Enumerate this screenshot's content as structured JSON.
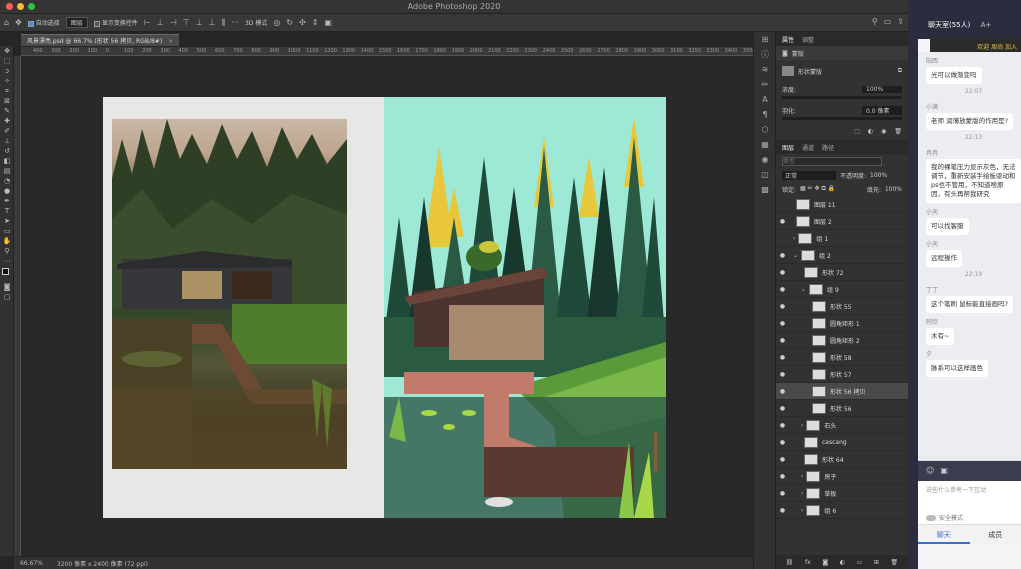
{
  "window": {
    "title": "Adobe Photoshop 2020"
  },
  "options_bar": {
    "auto_select_label": "自动选择",
    "auto_select_value": "图层",
    "show_transform_label": "显示变换控件",
    "mode_label": "3D 模式"
  },
  "document": {
    "tab_title": "风景漂亮.psd @ 66.7% (形状 56 拷贝, RGB/8#)"
  },
  "ruler_ticks": [
    "400",
    "300",
    "200",
    "100",
    "0",
    "100",
    "200",
    "300",
    "400",
    "500",
    "600",
    "700",
    "800",
    "900",
    "1000",
    "1100",
    "1200",
    "1300",
    "1400",
    "1500",
    "1600",
    "1700",
    "1800",
    "1900",
    "2000",
    "2100",
    "2200",
    "2300",
    "2400",
    "2500",
    "2600",
    "2700",
    "2800",
    "2900",
    "3000",
    "3100",
    "3200",
    "3300",
    "3400",
    "3500",
    "3600"
  ],
  "status": {
    "zoom": "66.67%",
    "doc_size": "3200 像素 x 2400 像素 (72 ppi)"
  },
  "properties": {
    "tabs": [
      "属性",
      "调整"
    ],
    "header": "蒙版",
    "mask_type": "形状蒙版",
    "density_label": "浓度:",
    "density_value": "100%",
    "feather_label": "羽化:",
    "feather_value": "0.0 像素"
  },
  "layers_panel": {
    "tabs": [
      "图层",
      "通道",
      "路径"
    ],
    "search_placeholder": "类型",
    "blend_mode": "正常",
    "opacity_label": "不透明度:",
    "opacity_value": "100%",
    "lock_label": "锁定:",
    "fill_label": "填充:",
    "fill_value": "100%",
    "layers": [
      {
        "name": "图层 11",
        "eye": "",
        "indent": 0,
        "fold": "",
        "selected": false
      },
      {
        "name": "图层 2",
        "eye": "●",
        "indent": 0,
        "fold": "",
        "selected": false
      },
      {
        "name": "组 1",
        "eye": "",
        "indent": 0,
        "fold": "›",
        "selected": false
      },
      {
        "name": "组 2",
        "eye": "●",
        "indent": 0,
        "fold": "⌄",
        "selected": false
      },
      {
        "name": "形状 72",
        "eye": "●",
        "indent": 1,
        "fold": "",
        "selected": false
      },
      {
        "name": "组 9",
        "eye": "●",
        "indent": 1,
        "fold": "⌄",
        "selected": false
      },
      {
        "name": "形状 55",
        "eye": "●",
        "indent": 2,
        "fold": "",
        "selected": false
      },
      {
        "name": "圆角矩形 1",
        "eye": "●",
        "indent": 2,
        "fold": "",
        "selected": false
      },
      {
        "name": "圆角矩形 2",
        "eye": "●",
        "indent": 2,
        "fold": "",
        "selected": false
      },
      {
        "name": "形状 58",
        "eye": "●",
        "indent": 2,
        "fold": "",
        "selected": false
      },
      {
        "name": "形状 57",
        "eye": "●",
        "indent": 2,
        "fold": "",
        "selected": false
      },
      {
        "name": "形状 56 拷贝",
        "eye": "●",
        "indent": 2,
        "fold": "",
        "selected": true
      },
      {
        "name": "形状 56",
        "eye": "●",
        "indent": 2,
        "fold": "",
        "selected": false
      },
      {
        "name": "石头",
        "eye": "●",
        "indent": 1,
        "fold": "›",
        "selected": false
      },
      {
        "name": "cascang",
        "eye": "●",
        "indent": 1,
        "fold": "",
        "selected": false
      },
      {
        "name": "形状 64",
        "eye": "●",
        "indent": 1,
        "fold": "",
        "selected": false
      },
      {
        "name": "房子",
        "eye": "●",
        "indent": 1,
        "fold": "›",
        "selected": false
      },
      {
        "name": "草板",
        "eye": "●",
        "indent": 1,
        "fold": "›",
        "selected": false
      },
      {
        "name": "组 6",
        "eye": "●",
        "indent": 1,
        "fold": "›",
        "selected": false
      }
    ]
  },
  "chat": {
    "header_title": "聊天室(55人)",
    "header_font_btn": "A+",
    "banner": "欢迎 周尚 加入",
    "messages": [
      {
        "time": "",
        "name": "阳西",
        "text": "光可以做渐变吗"
      },
      {
        "time": "22:07",
        "name": "小满",
        "text": "老师 润薄放蒙版的作用是?"
      },
      {
        "time": "22:13",
        "name": "冉冉",
        "text": "我的裸笔压力显示灰色，无法调节，重新安装手绘板驱动和ps也不管用，不知道啥原因，有头再帮我研究"
      },
      {
        "time": "",
        "name": "小天",
        "text": "可以找客服"
      },
      {
        "time": "",
        "name": "小天",
        "text": "远程操作"
      },
      {
        "time": "22:19",
        "name": "丁丁",
        "text": "这个笔刷 鼠标能直接画吗?"
      },
      {
        "time": "",
        "name": "阿欣",
        "text": "木有~"
      },
      {
        "time": "",
        "name": "夕",
        "text": "脉系可以这样画色"
      }
    ],
    "input_hint": "说些什么参考一下互动",
    "safe_mode_label": "安全模式",
    "tabs": [
      "聊天",
      "成员"
    ]
  }
}
